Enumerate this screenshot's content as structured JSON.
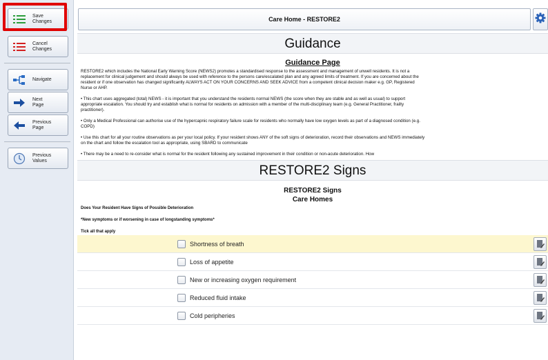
{
  "sidebar": {
    "buttons": [
      {
        "label": "Save\nChanges",
        "icon": "list-green-icon"
      },
      {
        "label": "Cancel\nChanges",
        "icon": "list-red-icon"
      },
      {
        "label": "Navigate",
        "icon": "tree-icon"
      },
      {
        "label": "Next\nPage",
        "icon": "arrow-right-icon"
      },
      {
        "label": "Previous\nPage",
        "icon": "arrow-left-icon"
      },
      {
        "label": "Previous\nValues",
        "icon": "history-icon"
      }
    ]
  },
  "header": {
    "title": "Care Home - RESTORE2"
  },
  "guidance": {
    "section_title": "Guidance",
    "page_title": "Guidance Page",
    "paragraphs": [
      "RESTORE2 which includes the National Early Warning Score (NEWS2) promotes a standardised response to the assessment and management of unwell residents. It is not a replacement for clinical judgement and should always be used with reference to the persons care/escalated plan and any agreed limits of treatment. If you are concerned about the resident or if one observation has changed significantly ALWAYS ACT ON YOUR CONCERNS AND SEEK ADVICE from a competent clinical decision maker e.g. GP, Registered Nurse or AHP.",
      "• This chart uses aggregated (total) NEWS - it is important that you understand the residents normal NEWS (the score when they are stable and as well as usual) to support appropriate escalation. You should try and establish what is normal for residents on admission with a member of the multi-disciplinary team (e.g. General Practitioner, frailty practitioner).",
      "• Only a Medical Professional can authorise use of the hypercapnic respiratory failure scale for residents who normally have low oxygen levels as part of a diagnosed condition (e.g. COPD)",
      "• Use this chart for all your routine observations as per your local policy. If your resident shows ANY of the soft signs of deterioration, record their observations and NEWS immediately on the chart and follow the escalation tool as appropriate, using SBARD to communicate",
      "• There may be a need to re-consider what is normal for the resident following any sustained improvement in their condition or non-acute deterioration. How"
    ]
  },
  "signs": {
    "section_title": "RESTORE2 Signs",
    "title": "RESTORE2 Signs",
    "subtitle": "Care Homes",
    "question": "Does Your Resident Have Signs of Possible Deterioration",
    "note": "*New symptoms or if worsening in case of longstanding symptoms*",
    "instruction": "Tick all that apply",
    "items": [
      {
        "label": "Shortness of breath"
      },
      {
        "label": "Loss of appetite"
      },
      {
        "label": "New or increasing oxygen requirement"
      },
      {
        "label": "Reduced fluid intake"
      },
      {
        "label": "Cold peripheries"
      }
    ]
  }
}
